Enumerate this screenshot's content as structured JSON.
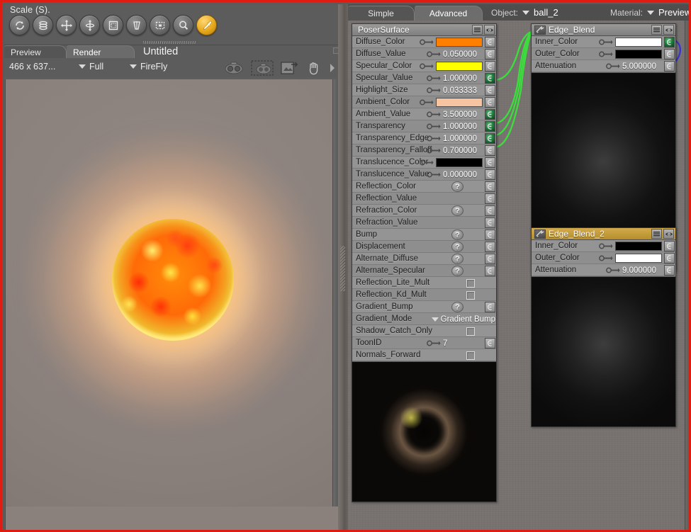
{
  "left_panel": {
    "status_text": "Scale (S).",
    "tools": [
      {
        "name": "rotate-tool",
        "icon": "rotate-icon"
      },
      {
        "name": "twist-tool",
        "icon": "twist-icon"
      },
      {
        "name": "translate-pull-tool",
        "icon": "move-icon"
      },
      {
        "name": "translate-inout-tool",
        "icon": "updown-icon"
      },
      {
        "name": "scale-tool",
        "icon": "scale-icon"
      },
      {
        "name": "taper-tool",
        "icon": "taper-icon"
      },
      {
        "name": "chain-break-tool",
        "icon": "chainbreak-icon"
      },
      {
        "name": "grouping-tool",
        "icon": "magnifier-icon"
      },
      {
        "name": "color-picker-tool",
        "icon": "eyedropper-icon"
      }
    ],
    "tabs": [
      {
        "label": "Preview",
        "active": false
      },
      {
        "label": "Render",
        "active": true
      }
    ],
    "document_title": "Untitled",
    "render_bar": {
      "dimensions": "466 x 637...",
      "quality": "Full",
      "engine": "FireFly",
      "icons": [
        {
          "name": "render-camera-icon"
        },
        {
          "name": "area-render-icon"
        },
        {
          "name": "export-image-icon"
        },
        {
          "name": "hand-pan-icon"
        },
        {
          "name": "next-arrow-icon"
        }
      ]
    }
  },
  "material_room": {
    "tabs": [
      {
        "label": "Simple",
        "active": false
      },
      {
        "label": "Advanced",
        "active": true
      }
    ],
    "object": {
      "label": "Object:",
      "value": "ball_2"
    },
    "material": {
      "label": "Material:",
      "value": "Preview"
    }
  },
  "nodes": [
    {
      "id": "poser-surface",
      "title": "PoserSurface",
      "selected": false,
      "has_plug_icon": false,
      "rows": [
        {
          "label": "Diffuse_Color",
          "type": "color",
          "value": "#FF8000",
          "key": true,
          "plug": false
        },
        {
          "label": "Diffuse_Value",
          "type": "number",
          "value": "0.050000",
          "key": true,
          "plug": false
        },
        {
          "label": "Specular_Color",
          "type": "color",
          "value": "#FFFF00",
          "key": true,
          "plug": false
        },
        {
          "label": "Specular_Value",
          "type": "number",
          "value": "1.000000",
          "key": true,
          "plug": true
        },
        {
          "label": "Highlight_Size",
          "type": "number",
          "value": "0.033333",
          "key": true,
          "plug": false
        },
        {
          "label": "Ambient_Color",
          "type": "color",
          "value": "#F7C4A1",
          "key": true,
          "plug": false
        },
        {
          "label": "Ambient_Value",
          "type": "number",
          "value": "3.500000",
          "key": true,
          "plug": true
        },
        {
          "label": "Transparency",
          "type": "number",
          "value": "1.000000",
          "key": true,
          "plug": true
        },
        {
          "label": "Transparency_Edge",
          "type": "number",
          "value": "1.000000",
          "key": true,
          "plug": true
        },
        {
          "label": "Transparency_Falloff",
          "type": "number",
          "value": "0.700000",
          "key": true,
          "plug": false
        },
        {
          "label": "Translucence_Color",
          "type": "color",
          "value": "#000000",
          "key": true,
          "plug": false
        },
        {
          "label": "Translucence_Value",
          "type": "number",
          "value": "0.000000",
          "key": true,
          "plug": false
        },
        {
          "label": "Reflection_Color",
          "type": "qmark",
          "value": "?",
          "key": false,
          "plug": false
        },
        {
          "label": "Reflection_Value",
          "type": "empty",
          "value": "",
          "key": false,
          "plug": false
        },
        {
          "label": "Refraction_Color",
          "type": "qmark",
          "value": "?",
          "key": false,
          "plug": false
        },
        {
          "label": "Refraction_Value",
          "type": "empty",
          "value": "",
          "key": false,
          "plug": false
        },
        {
          "label": "Bump",
          "type": "qmark",
          "value": "?",
          "key": false,
          "plug": false
        },
        {
          "label": "Displacement",
          "type": "qmark",
          "value": "?",
          "key": false,
          "plug": false
        },
        {
          "label": "Alternate_Diffuse",
          "type": "qmark",
          "value": "?",
          "key": false,
          "plug": false
        },
        {
          "label": "Alternate_Specular",
          "type": "qmark",
          "value": "?",
          "key": false,
          "plug": false
        },
        {
          "label": "Reflection_Lite_Mult",
          "type": "check",
          "value": "",
          "key": false,
          "plug": false
        },
        {
          "label": "Reflection_Kd_Mult",
          "type": "check",
          "value": "",
          "key": false,
          "plug": false
        },
        {
          "label": "Gradient_Bump",
          "type": "qmark",
          "value": "?",
          "key": false,
          "plug": false
        },
        {
          "label": "Gradient_Mode",
          "type": "mode",
          "value": "Gradient Bump",
          "key": false,
          "plug": false
        },
        {
          "label": "Shadow_Catch_Only",
          "type": "check",
          "value": "",
          "key": false,
          "plug": false
        },
        {
          "label": "ToonID",
          "type": "number",
          "value": "7",
          "key": true,
          "plug": false
        },
        {
          "label": "Normals_Forward",
          "type": "check",
          "value": "",
          "key": false,
          "plug": false
        }
      ]
    },
    {
      "id": "edge-blend",
      "title": "Edge_Blend",
      "selected": false,
      "has_plug_icon": true,
      "rows": [
        {
          "label": "Inner_Color",
          "type": "color",
          "value": "#FFFFFF",
          "key": true,
          "plug": true
        },
        {
          "label": "Outer_Color",
          "type": "color",
          "value": "#000000",
          "key": true,
          "plug": false
        },
        {
          "label": "Attenuation",
          "type": "number",
          "value": "5.000000",
          "key": true,
          "plug": false
        }
      ]
    },
    {
      "id": "edge-blend-2",
      "title": "Edge_Blend_2",
      "selected": true,
      "has_plug_icon": true,
      "rows": [
        {
          "label": "Inner_Color",
          "type": "color",
          "value": "#000000",
          "key": true,
          "plug": false
        },
        {
          "label": "Outer_Color",
          "type": "color",
          "value": "#FFFFFF",
          "key": true,
          "plug": false
        },
        {
          "label": "Attenuation",
          "type": "number",
          "value": "9.000000",
          "key": true,
          "plug": false
        }
      ]
    }
  ],
  "wires": {
    "connection_color_green": "#3ddb3d",
    "connection_color_blue": "#3a36cc"
  },
  "theme": {
    "window_border": "#e01b12",
    "panel_bg": "#5c5c5c",
    "node_bg": "#949494",
    "canvas_bg": "#777270",
    "selected_header": "#c09a3c"
  }
}
